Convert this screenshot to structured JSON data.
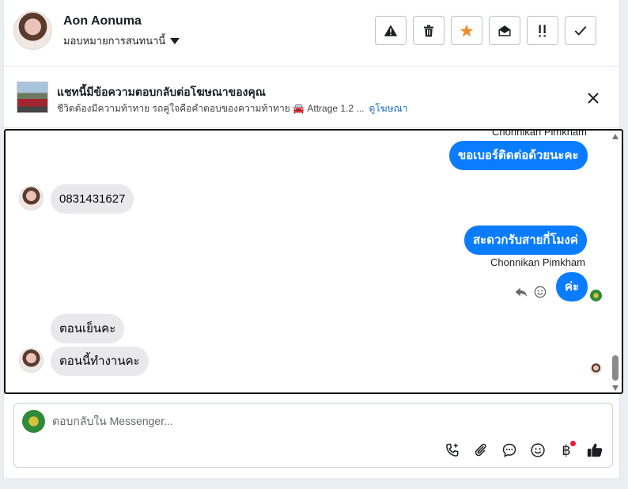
{
  "header": {
    "name": "Aon Aonuma",
    "assign_label": "มอบหมายการสนทนานี้"
  },
  "toolbar": {
    "buttons": [
      "warning-icon",
      "trash-icon",
      "star-icon",
      "mark-unread-icon",
      "priority-icon",
      "check-icon"
    ],
    "star_color": "#f28c28"
  },
  "ad": {
    "title": "แชทนี้มีข้อความตอบกลับต่อโฆษณาของคุณ",
    "subtitle": "ชีวิตต้องมีความท้าทาย รถคู่ใจคือคำตอบของความท้าทาย 🚘 Attrage 1.2 ...",
    "link": "ดูโฆษณา"
  },
  "conversation": {
    "top_sender": "Chonnikan Pimkham",
    "messages": [
      {
        "direction": "out",
        "text": "ขอเบอร์ติดต่อด้วยนะคะ"
      },
      {
        "direction": "in",
        "text": "0831431627"
      },
      {
        "direction": "out",
        "text": "สะดวกรับสายกี่โมงค่",
        "sender": "Chonnikan Pimkham"
      },
      {
        "direction": "out",
        "text": "ค่ะ"
      },
      {
        "direction": "in",
        "text": "ตอนเย็นคะ"
      },
      {
        "direction": "in",
        "text": "ตอนนี้ทำงานคะ"
      }
    ],
    "outgoing_color": "#0a7cff",
    "incoming_color": "#e9e9eb"
  },
  "composer": {
    "placeholder": "ตอบกลับใน Messenger...",
    "tools": [
      "phone-add-icon",
      "paperclip-icon",
      "chat-bubble-icon",
      "emoji-icon",
      "baht-icon",
      "thumbs-up-icon"
    ],
    "baht_symbol": "฿"
  }
}
